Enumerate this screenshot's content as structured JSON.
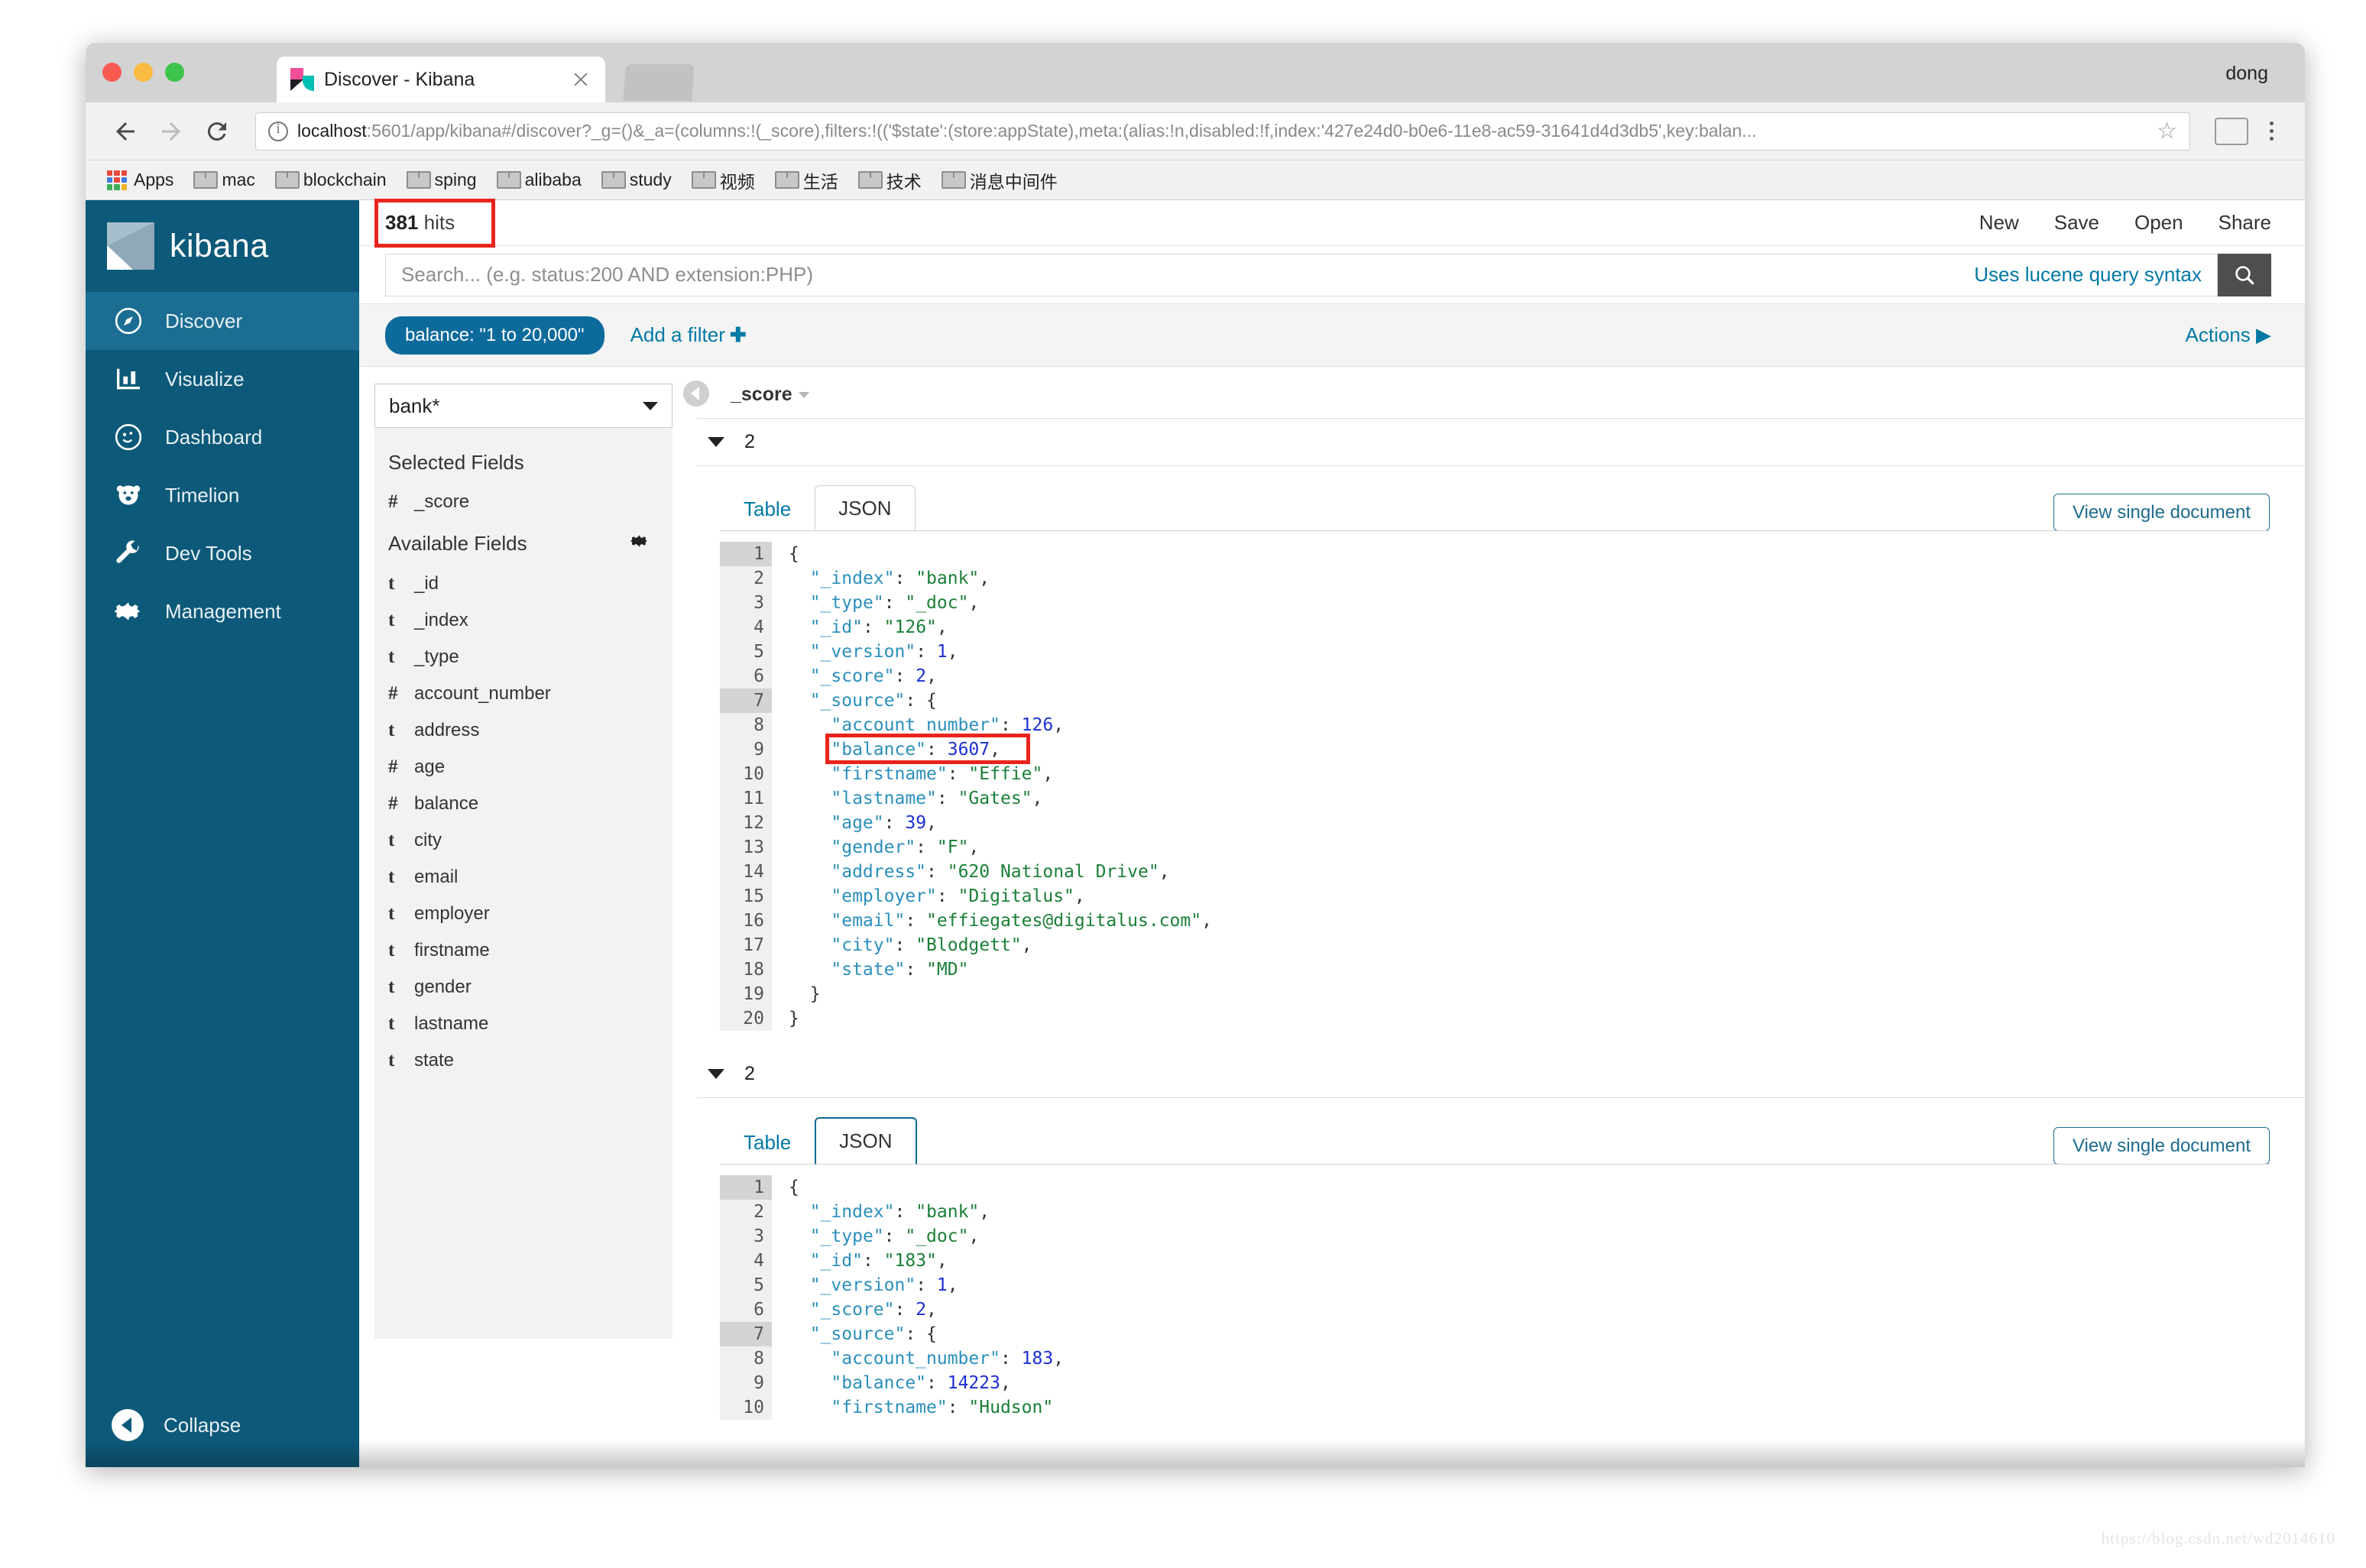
{
  "browser": {
    "tab_title": "Discover - Kibana",
    "profile_name": "dong",
    "url_host": "localhost",
    "url_rest": ":5601/app/kibana#/discover?_g=()&_a=(columns:!(_score),filters:!(('$state':(store:appState),meta:(alias:!n,disabled:!f,index:'427e24d0-b0e6-11e8-ac59-31641d4d3db5',key:balan...",
    "bookmarks": [
      {
        "label": "Apps",
        "icon": "apps-grid-icon"
      },
      {
        "label": "mac",
        "icon": "folder-icon"
      },
      {
        "label": "blockchain",
        "icon": "folder-icon"
      },
      {
        "label": "sping",
        "icon": "folder-icon"
      },
      {
        "label": "alibaba",
        "icon": "folder-icon"
      },
      {
        "label": "study",
        "icon": "folder-icon"
      },
      {
        "label": "视频",
        "icon": "folder-icon"
      },
      {
        "label": "生活",
        "icon": "folder-icon"
      },
      {
        "label": "技术",
        "icon": "folder-icon"
      },
      {
        "label": "消息中间件",
        "icon": "folder-icon"
      }
    ]
  },
  "sidebar": {
    "logo_text": "kibana",
    "items": [
      {
        "label": "Discover",
        "icon": "compass-icon",
        "active": true
      },
      {
        "label": "Visualize",
        "icon": "bar-chart-icon",
        "active": false
      },
      {
        "label": "Dashboard",
        "icon": "dashboard-icon",
        "active": false
      },
      {
        "label": "Timelion",
        "icon": "bear-icon",
        "active": false
      },
      {
        "label": "Dev Tools",
        "icon": "wrench-icon",
        "active": false
      },
      {
        "label": "Management",
        "icon": "gear-icon",
        "active": false
      }
    ],
    "collapse_label": "Collapse"
  },
  "topbar": {
    "hits_count": "381",
    "hits_label": "hits",
    "nav": [
      "New",
      "Save",
      "Open",
      "Share"
    ]
  },
  "search": {
    "placeholder": "Search... (e.g. status:200 AND extension:PHP)",
    "lucene_link": "Uses lucene query syntax",
    "search_icon": "magnifier-icon"
  },
  "filters": {
    "pill_label": "balance: \"1 to 20,000\"",
    "add_filter_label": "Add a filter",
    "add_filter_plus": "✚",
    "actions_label": "Actions"
  },
  "fieldpanel": {
    "index_pattern": "bank*",
    "selected_title": "Selected Fields",
    "available_title": "Available Fields",
    "selected_fields": [
      {
        "type": "#",
        "name": "_score"
      }
    ],
    "available_fields": [
      {
        "type": "t",
        "name": "_id"
      },
      {
        "type": "t",
        "name": "_index"
      },
      {
        "type": "t",
        "name": "_type"
      },
      {
        "type": "#",
        "name": "account_number"
      },
      {
        "type": "t",
        "name": "address"
      },
      {
        "type": "#",
        "name": "age"
      },
      {
        "type": "#",
        "name": "balance"
      },
      {
        "type": "t",
        "name": "city"
      },
      {
        "type": "t",
        "name": "email"
      },
      {
        "type": "t",
        "name": "employer"
      },
      {
        "type": "t",
        "name": "firstname"
      },
      {
        "type": "t",
        "name": "gender"
      },
      {
        "type": "t",
        "name": "lastname"
      },
      {
        "type": "t",
        "name": "state"
      }
    ]
  },
  "doctable": {
    "column_header": "_score",
    "tab_table": "Table",
    "tab_json": "JSON",
    "view_single_document": "View single document",
    "documents": [
      {
        "score": "2",
        "lines": [
          {
            "n": "1",
            "fold": true,
            "code": "{"
          },
          {
            "n": "2",
            "fold": false,
            "code": "  \"_index\": \"bank\","
          },
          {
            "n": "3",
            "fold": false,
            "code": "  \"_type\": \"_doc\","
          },
          {
            "n": "4",
            "fold": false,
            "code": "  \"_id\": \"126\","
          },
          {
            "n": "5",
            "fold": false,
            "code": "  \"_version\": 1,"
          },
          {
            "n": "6",
            "fold": false,
            "code": "  \"_score\": 2,"
          },
          {
            "n": "7",
            "fold": true,
            "code": "  \"_source\": {"
          },
          {
            "n": "8",
            "fold": false,
            "code": "    \"account_number\": 126,"
          },
          {
            "n": "9",
            "fold": false,
            "code": "    \"balance\": 3607,"
          },
          {
            "n": "10",
            "fold": false,
            "code": "    \"firstname\": \"Effie\","
          },
          {
            "n": "11",
            "fold": false,
            "code": "    \"lastname\": \"Gates\","
          },
          {
            "n": "12",
            "fold": false,
            "code": "    \"age\": 39,"
          },
          {
            "n": "13",
            "fold": false,
            "code": "    \"gender\": \"F\","
          },
          {
            "n": "14",
            "fold": false,
            "code": "    \"address\": \"620 National Drive\","
          },
          {
            "n": "15",
            "fold": false,
            "code": "    \"employer\": \"Digitalus\","
          },
          {
            "n": "16",
            "fold": false,
            "code": "    \"email\": \"effiegates@digitalus.com\","
          },
          {
            "n": "17",
            "fold": false,
            "code": "    \"city\": \"Blodgett\","
          },
          {
            "n": "18",
            "fold": false,
            "code": "    \"state\": \"MD\""
          },
          {
            "n": "19",
            "fold": false,
            "code": "  }"
          },
          {
            "n": "20",
            "fold": false,
            "code": "}"
          }
        ]
      },
      {
        "score": "2",
        "lines": [
          {
            "n": "1",
            "fold": true,
            "code": "{"
          },
          {
            "n": "2",
            "fold": false,
            "code": "  \"_index\": \"bank\","
          },
          {
            "n": "3",
            "fold": false,
            "code": "  \"_type\": \"_doc\","
          },
          {
            "n": "4",
            "fold": false,
            "code": "  \"_id\": \"183\","
          },
          {
            "n": "5",
            "fold": false,
            "code": "  \"_version\": 1,"
          },
          {
            "n": "6",
            "fold": false,
            "code": "  \"_score\": 2,"
          },
          {
            "n": "7",
            "fold": true,
            "code": "  \"_source\": {"
          },
          {
            "n": "8",
            "fold": false,
            "code": "    \"account_number\": 183,"
          },
          {
            "n": "9",
            "fold": false,
            "code": "    \"balance\": 14223,"
          },
          {
            "n": "10",
            "fold": false,
            "code": "    \"firstname\": \"Hudson\""
          }
        ]
      }
    ]
  },
  "watermark": "https://blog.csdn.net/wd2014610",
  "colors": {
    "sidebar_bg": "#0d5979",
    "sidebar_active": "#1b6e91",
    "accent_link": "#0079a5",
    "filter_pill": "#0d6b9c",
    "highlight_red": "#e8241c"
  }
}
